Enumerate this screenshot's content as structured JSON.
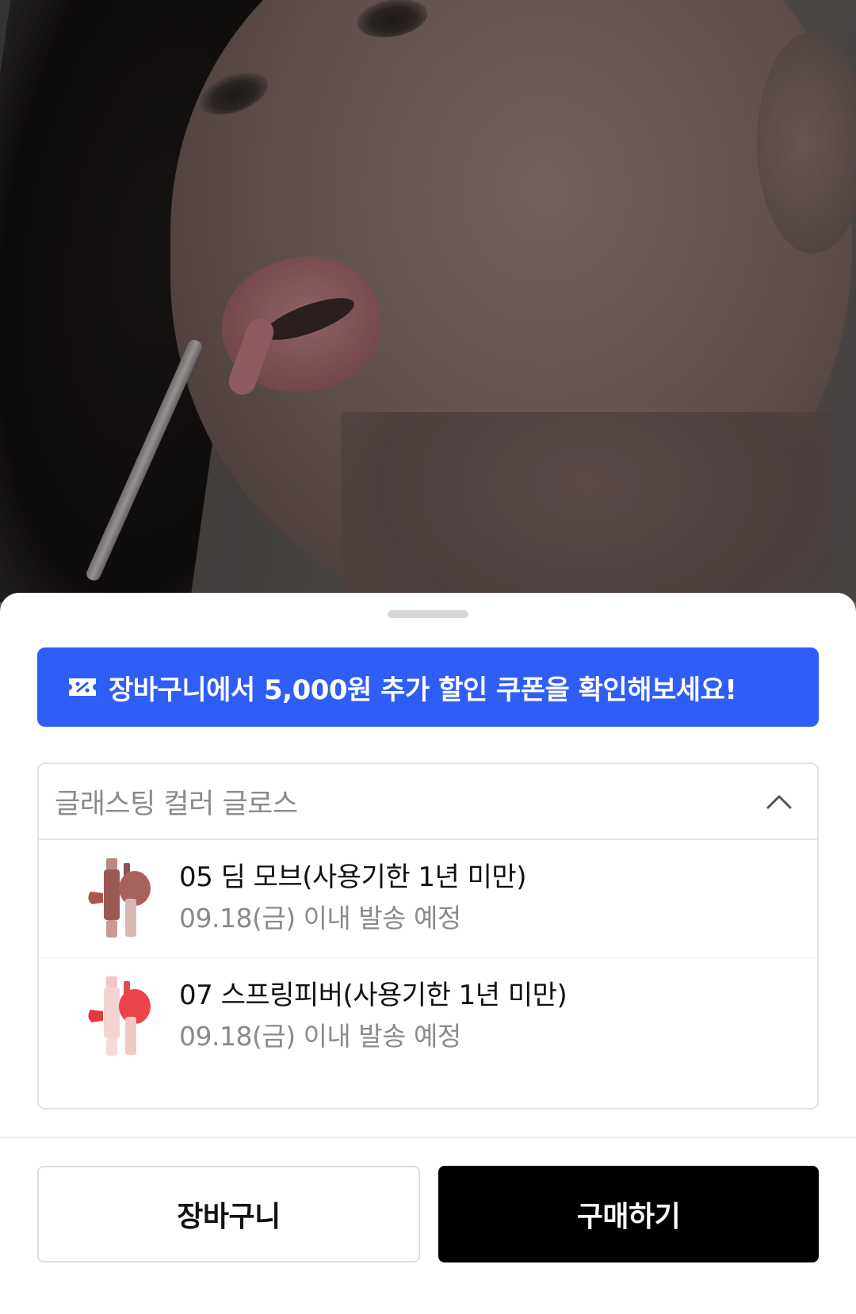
{
  "coupon_banner": {
    "text": "장바구니에서 5,000원 추가 할인 쿠폰을 확인해보세요!",
    "color": "#2f5ef7",
    "icon": "coupon-ticket-icon"
  },
  "option_selector": {
    "title": "글래스팅 컬러 글로스",
    "expanded": true,
    "icon": "chevron-up-icon",
    "items": [
      {
        "name": "05 딤 모브(사용기한 1년 미만)",
        "shipping": "09.18(금) 이내 발송 예정",
        "thumb_color": "#9a5a54"
      },
      {
        "name": "07 스프링피버(사용기한 1년 미만)",
        "shipping": "09.18(금) 이내 발송 예정",
        "thumb_color": "#e24a4c"
      }
    ]
  },
  "actions": {
    "cart_label": "장바구니",
    "buy_label": "구매하기"
  }
}
